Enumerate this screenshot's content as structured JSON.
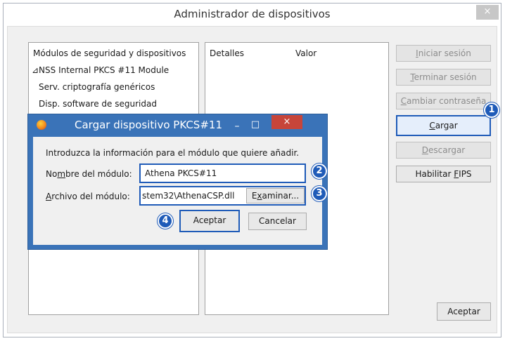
{
  "window": {
    "title": "Administrador de dispositivos",
    "close_glyph": "×"
  },
  "tree": {
    "header": "Módulos de seguridad y dispositivos",
    "items": [
      {
        "label": "⊿NSS Internal PKCS #11 Module"
      },
      {
        "label": "Serv. criptografía genéricos"
      },
      {
        "label": "Disp. software de seguridad"
      }
    ]
  },
  "details": {
    "col_detalles": "Detalles",
    "col_valor": "Valor"
  },
  "side_buttons": {
    "iniciar_pre": "",
    "iniciar_u": "I",
    "iniciar_post": "niciar sesión",
    "terminar_pre": "",
    "terminar_u": "T",
    "terminar_post": "erminar sesión",
    "cambiar_pre": "",
    "cambiar_u": "C",
    "cambiar_post": "ambiar contraseña",
    "cargar_pre": "",
    "cargar_u": "C",
    "cargar_post": "argar",
    "descargar_pre": "",
    "descargar_u": "D",
    "descargar_post": "escargar",
    "fips_pre": "Habilitar ",
    "fips_u": "F",
    "fips_post": "IPS"
  },
  "main_ok": "Aceptar",
  "dialog": {
    "title": "Cargar dispositivo PKCS#11",
    "min_glyph": "–",
    "max_glyph": "□",
    "close_glyph": "×",
    "intro": "Introduzca la información para el módulo que quiere añadir.",
    "name_label_pre": "No",
    "name_label_u": "m",
    "name_label_post": "bre del módulo:",
    "name_value": "Athena PKCS#11",
    "file_label_pre": "",
    "file_label_u": "A",
    "file_label_post": "rchivo del módulo:",
    "file_value": "stem32\\AthenaCSP.dll",
    "browse_pre": "E",
    "browse_u": "x",
    "browse_post": "aminar...",
    "accept": "Aceptar",
    "cancel": "Cancelar"
  },
  "badges": [
    "1",
    "2",
    "3",
    "4"
  ],
  "colors": {
    "accent": "#1f5bb8",
    "dialog_frame": "#3a73b8",
    "close_red": "#c7453a"
  }
}
